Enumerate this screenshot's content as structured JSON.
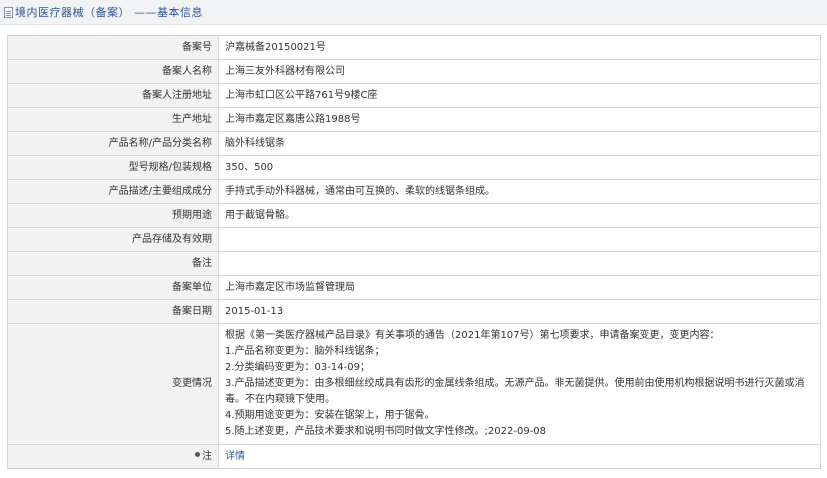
{
  "header": {
    "title": "境内医疗器械（备案） ——基本信息"
  },
  "rows": [
    {
      "label": "备案号",
      "value": "沪嘉械备20150021号"
    },
    {
      "label": "备案人名称",
      "value": "上海三友外科器材有限公司"
    },
    {
      "label": "备案人注册地址",
      "value": "上海市虹口区公平路761号9楼C座"
    },
    {
      "label": "生产地址",
      "value": "上海市嘉定区嘉唐公路1988号"
    },
    {
      "label": "产品名称/产品分类名称",
      "value": "脑外科线锯条"
    },
    {
      "label": "型号规格/包装规格",
      "value": "350、500"
    },
    {
      "label": "产品描述/主要组成成分",
      "value": "手持式手动外科器械，通常由可互换的、柔软的线锯条组成。"
    },
    {
      "label": "预期用途",
      "value": "用于截锯骨骼。"
    },
    {
      "label": "产品存储及有效期",
      "value": ""
    },
    {
      "label": "备注",
      "value": ""
    },
    {
      "label": "备案单位",
      "value": "上海市嘉定区市场监督管理局"
    },
    {
      "label": "备案日期",
      "value": "2015-01-13"
    }
  ],
  "changes": {
    "label": "变更情况",
    "lines": [
      "根据《第一类医疗器械产品目录》有关事项的通告（2021年第107号）第七项要求，申请备案变更，变更内容：",
      "1.产品名称变更为：脑外科线锯条；",
      "2.分类编码变更为：03-14-09；",
      "3.产品描述变更为：由多根细丝绞成具有齿形的金属线条组成。无源产品。非无菌提供。使用前由使用机构根据说明书进行灭菌或消毒。不在内窥镜下使用。",
      "4.预期用途变更为：安装在锯架上，用于锯骨。",
      "5.随上述变更，产品技术要求和说明书同时做文字性修改。;2022-09-08"
    ]
  },
  "footer_row": {
    "label": "注",
    "link": "详情"
  }
}
